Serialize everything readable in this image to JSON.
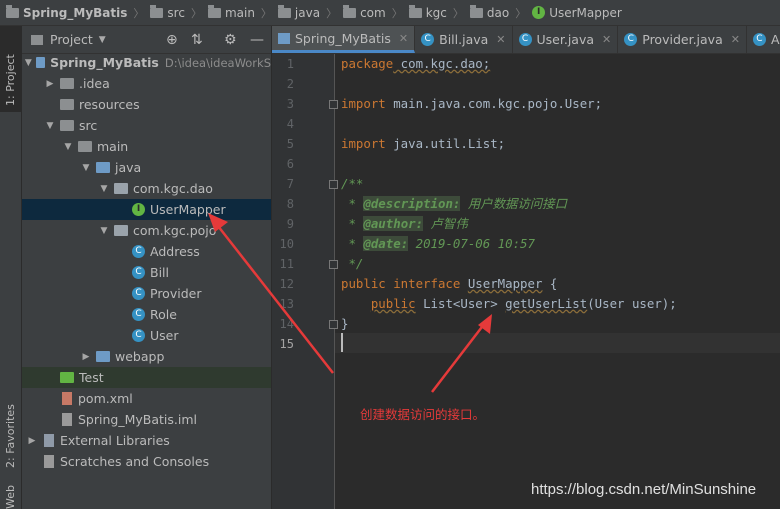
{
  "breadcrumb": [
    "Spring_MyBatis",
    "src",
    "main",
    "java",
    "com",
    "kgc",
    "dao",
    "UserMapper"
  ],
  "left_strip": {
    "project": "1: Project",
    "favorites": "2: Favorites",
    "web": "Web"
  },
  "project_panel": {
    "title": "Project",
    "tree": [
      {
        "label": "Spring_MyBatis",
        "extra": "D:\\idea\\ideaWorkS",
        "level": 0,
        "open": true,
        "icon": "module-folder"
      },
      {
        "label": ".idea",
        "level": 1,
        "open": false,
        "icon": "folder"
      },
      {
        "label": "resources",
        "level": 1,
        "icon": "resources-folder"
      },
      {
        "label": "src",
        "level": 1,
        "open": true,
        "icon": "folder"
      },
      {
        "label": "main",
        "level": 2,
        "open": true,
        "icon": "folder"
      },
      {
        "label": "java",
        "level": 3,
        "open": true,
        "icon": "source-folder"
      },
      {
        "label": "com.kgc.dao",
        "level": 4,
        "open": true,
        "icon": "package"
      },
      {
        "label": "UserMapper",
        "level": 5,
        "icon": "interface",
        "selected": true
      },
      {
        "label": "com.kgc.pojo",
        "level": 4,
        "open": true,
        "icon": "package"
      },
      {
        "label": "Address",
        "level": 5,
        "icon": "class"
      },
      {
        "label": "Bill",
        "level": 5,
        "icon": "class"
      },
      {
        "label": "Provider",
        "level": 5,
        "icon": "class"
      },
      {
        "label": "Role",
        "level": 5,
        "icon": "class"
      },
      {
        "label": "User",
        "level": 5,
        "icon": "class"
      },
      {
        "label": "webapp",
        "level": 3,
        "open": false,
        "icon": "web-folder"
      },
      {
        "label": "Test",
        "level": 1,
        "icon": "test-folder",
        "highlight": true
      },
      {
        "label": "pom.xml",
        "level": 1,
        "icon": "maven-file"
      },
      {
        "label": "Spring_MyBatis.iml",
        "level": 1,
        "icon": "iml-file"
      },
      {
        "label": "External Libraries",
        "level": 0,
        "open": false,
        "icon": "libraries"
      },
      {
        "label": "Scratches and Consoles",
        "level": 0,
        "icon": "scratches"
      }
    ]
  },
  "tabs": [
    {
      "label": "Spring_MyBatis",
      "icon": "module-icon",
      "active": true
    },
    {
      "label": "Bill.java",
      "icon": "class-icon"
    },
    {
      "label": "User.java",
      "icon": "class-icon"
    },
    {
      "label": "Provider.java",
      "icon": "class-icon"
    },
    {
      "label": "Add",
      "icon": "class-icon"
    }
  ],
  "line_numbers": [
    "1",
    "2",
    "3",
    "4",
    "5",
    "6",
    "7",
    "8",
    "9",
    "10",
    "11",
    "12",
    "13",
    "14",
    "15"
  ],
  "code": {
    "l1_kw": "package",
    "l1_rest": " com.kgc.dao;",
    "l3_kw": "import",
    "l3_rest": " main.java.com.kgc.pojo.User;",
    "l5_kw": "import",
    "l5_rest": " java.util.List;",
    "l7": "/**",
    "l8_tag": "@description:",
    "l8_text": " 用户数据访问接口",
    "l9_tag": "@author:",
    "l9_text": " 卢智伟",
    "l10_tag": "@date:",
    "l10_text": " 2019-07-06 10:57",
    "l11": " */",
    "l12_kw": "public interface",
    "l12_name": "UserMapper",
    "l12_rest": " {",
    "l13_kw": "public",
    "l13_type": " List<User> ",
    "l13_method": "getUserList",
    "l13_rest": "(User user);",
    "l14": "}",
    "star": " * "
  },
  "annotation": "创建数据访问的接口。",
  "watermark": "https://blog.csdn.net/MinSunshine",
  "colors": {
    "annotation": "#e53a3a",
    "selection": "#0d293e",
    "keyword": "#cc7832",
    "doc": "#629755"
  }
}
